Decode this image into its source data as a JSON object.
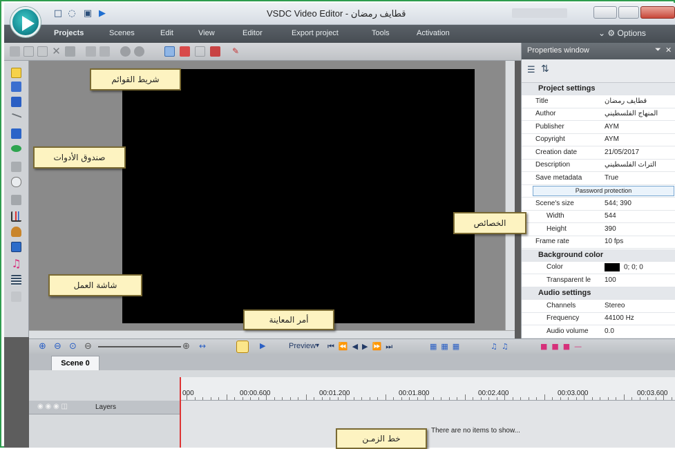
{
  "titlebar": {
    "title": "VSDC Video Editor - قطايف رمضان"
  },
  "menu": {
    "items": [
      "Projects",
      "Scenes",
      "Edit",
      "View",
      "Editor",
      "Export project",
      "Tools",
      "Activation"
    ],
    "options": "Options"
  },
  "properties": {
    "header": "Properties window",
    "rows": [
      {
        "type": "section",
        "label": "Project settings"
      },
      {
        "label": "Title",
        "value": "قطايف رمضان"
      },
      {
        "label": "Author",
        "value": "المنهاج الفلسطيني"
      },
      {
        "label": "Publisher",
        "value": "AYM"
      },
      {
        "label": "Copyright",
        "value": "AYM"
      },
      {
        "label": "Creation date",
        "value": "21/05/2017"
      },
      {
        "label": "Description",
        "value": "التراث الفلسطيني"
      },
      {
        "label": "Save metadata",
        "value": "True"
      },
      {
        "type": "button",
        "label": "Password protection"
      },
      {
        "label": "Scene's size",
        "value": "544; 390"
      },
      {
        "label": "Width",
        "value": "544",
        "indent": true
      },
      {
        "label": "Height",
        "value": "390",
        "indent": true
      },
      {
        "label": "Frame rate",
        "value": "10 fps"
      },
      {
        "type": "section",
        "label": "Background color"
      },
      {
        "label": "Color",
        "value": "0; 0; 0",
        "swatch": "#000000",
        "indent": true
      },
      {
        "label": "Transparent le",
        "value": "100",
        "indent": true
      },
      {
        "type": "section",
        "label": "Audio settings"
      },
      {
        "label": "Channels",
        "value": "Stereo",
        "indent": true
      },
      {
        "label": "Frequency",
        "value": "44100 Hz",
        "indent": true
      },
      {
        "label": "Audio volume",
        "value": "0.0",
        "indent": true
      }
    ]
  },
  "timeline": {
    "preview": "Preview",
    "tab": "Scene 0",
    "ticks": [
      "000",
      "00:00.600",
      "00:01.200",
      "00:01.800",
      "00:02.400",
      "00:03.000",
      "00:03.600"
    ],
    "layers": "Layers",
    "empty": "There are no items to show..."
  },
  "callouts": {
    "menu_bar": "شريط القوائم",
    "toolbox": "صندوق الأدوات",
    "workspace": "شاشة العمل",
    "properties": "الخصائص",
    "preview": "أمر المعاينة",
    "timeline": "خط الزمـن"
  },
  "colors": {
    "frame": "#2e9c4e",
    "callout_bg": "#fdf3c1",
    "scene": "#000000"
  }
}
